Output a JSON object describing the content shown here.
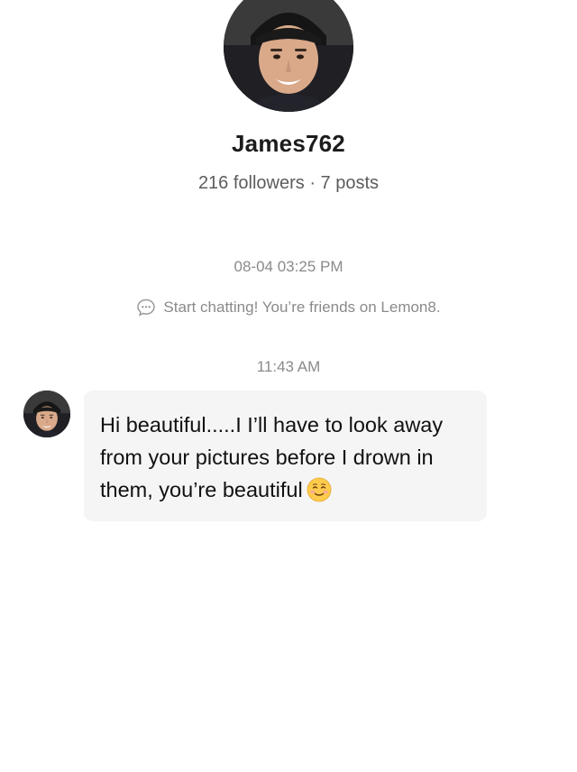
{
  "profile": {
    "username": "James762",
    "stats": "216 followers · 7 posts"
  },
  "chat": {
    "timestamp_first": "08-04 03:25 PM",
    "system_notice": "Start chatting! You’re friends on Lemon8.",
    "timestamp_second": "11:43 AM",
    "messages": [
      {
        "text": "Hi beautiful.....I I’ll have to look away from your pictures before I drown in them, you’re beautiful",
        "emoji": "smiling-face-icon"
      }
    ]
  },
  "colors": {
    "background": "#ffffff",
    "bubble": "#f5f5f5",
    "muted_text": "#8a8a8a",
    "stats_text": "#5c5c5c"
  }
}
